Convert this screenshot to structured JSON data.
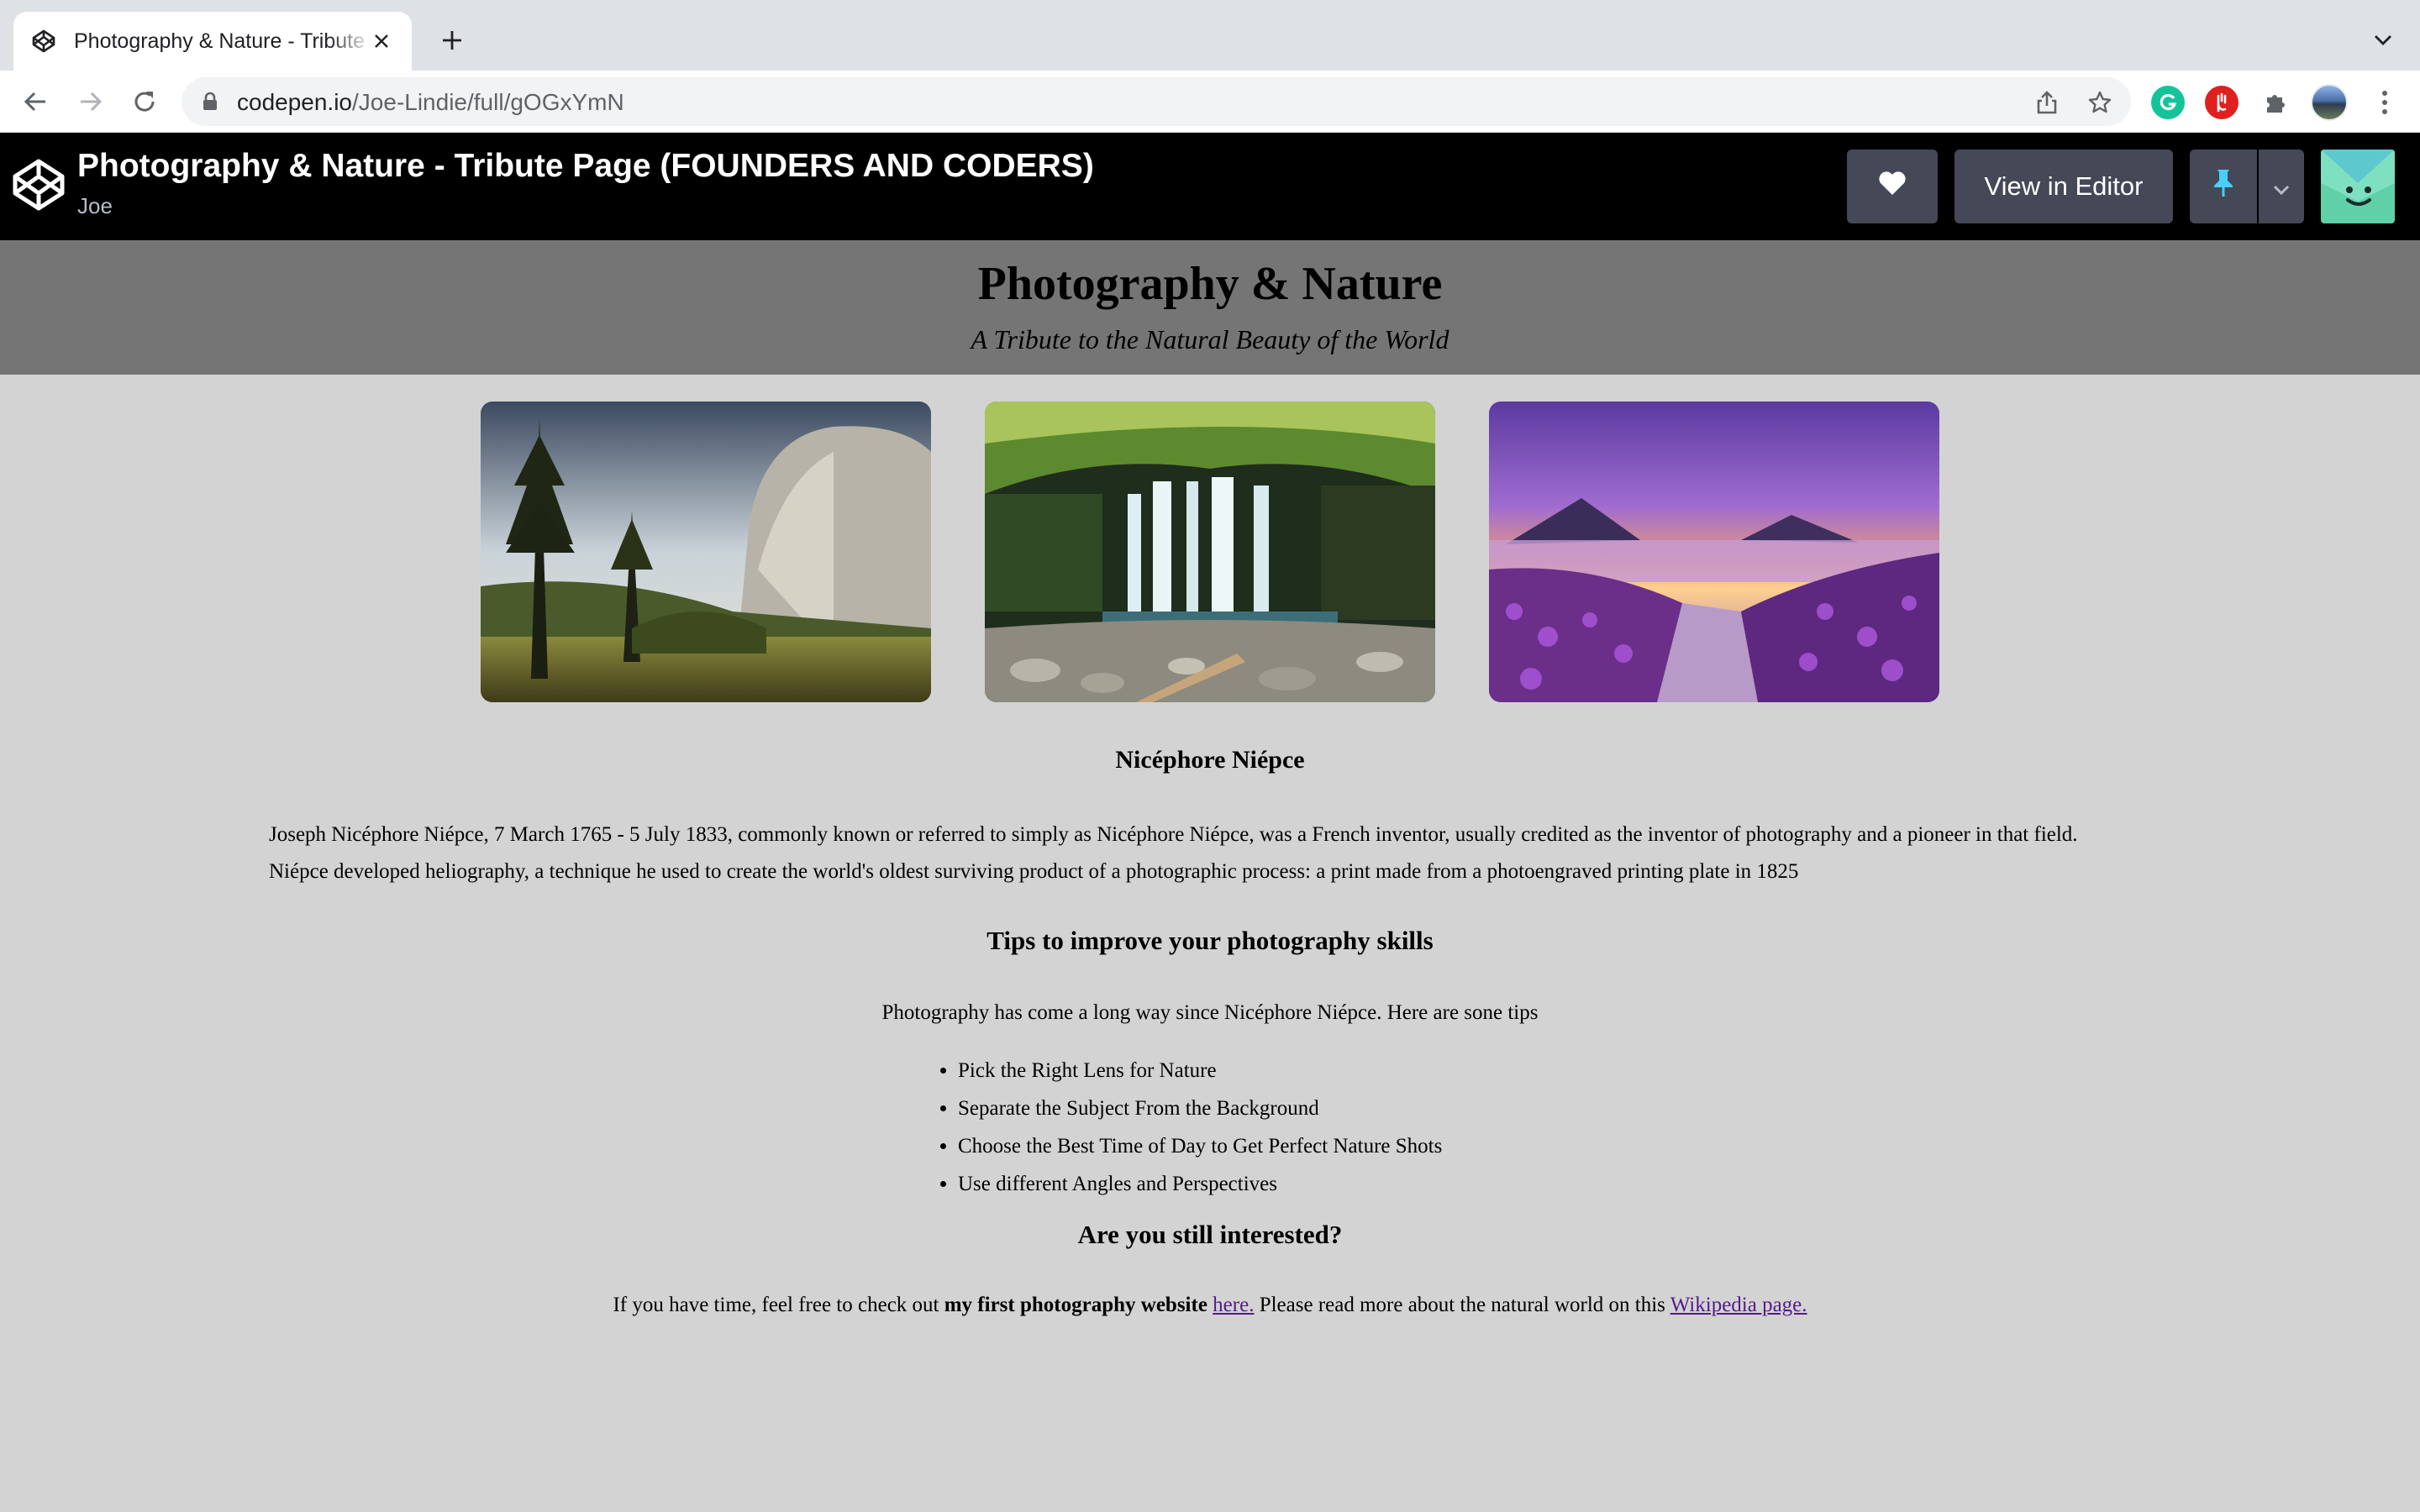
{
  "browser": {
    "tab_title": "Photography & Nature - Tribute Page (FOUNDERS AND CODERS)",
    "url_host": "codepen.io",
    "url_path": "/Joe-Lindie/full/gOGxYmN"
  },
  "codepen": {
    "title": "Photography & Nature - Tribute Page (FOUNDERS AND CODERS)",
    "author": "Joe",
    "view_in_editor_label": "View in Editor"
  },
  "page": {
    "title": "Photography & Nature",
    "subtitle": "A Tribute to the Natural Beauty of the World",
    "images": [
      "Yosemite valley",
      "Waterfall",
      "Lavender lake sunset"
    ],
    "bio_heading": "Nicéphore Niépce",
    "bio_line1": "Joseph Nicéphore Niépce, 7 March 1765 - 5 July 1833, commonly known or referred to simply as Nicéphore Niépce, was a French inventor, usually credited as the inventor of photography and a pioneer in that field.",
    "bio_line2": "Niépce developed heliography, a technique he used to create the world's oldest surviving product of a photographic process: a print made from a photoengraved printing plate in 1825",
    "tips_heading": "Tips to improve your photography skills",
    "tips_intro": "Photography has come a long way since Nicéphore Niépce. Here are sone tips",
    "tips": [
      "Pick the Right Lens for Nature",
      "Separate the Subject From the Background",
      "Choose the Best Time of Day to Get Perfect Nature Shots",
      "Use different Angles and Perspectives"
    ],
    "interest_heading": "Are you still interested?",
    "footer_pre": "If you have time, feel free to check out ",
    "footer_bold": "my first photography website",
    "footer_link1": "here.",
    "footer_mid": " Please read more about the natural world on this ",
    "footer_link2": "Wikipedia page."
  }
}
